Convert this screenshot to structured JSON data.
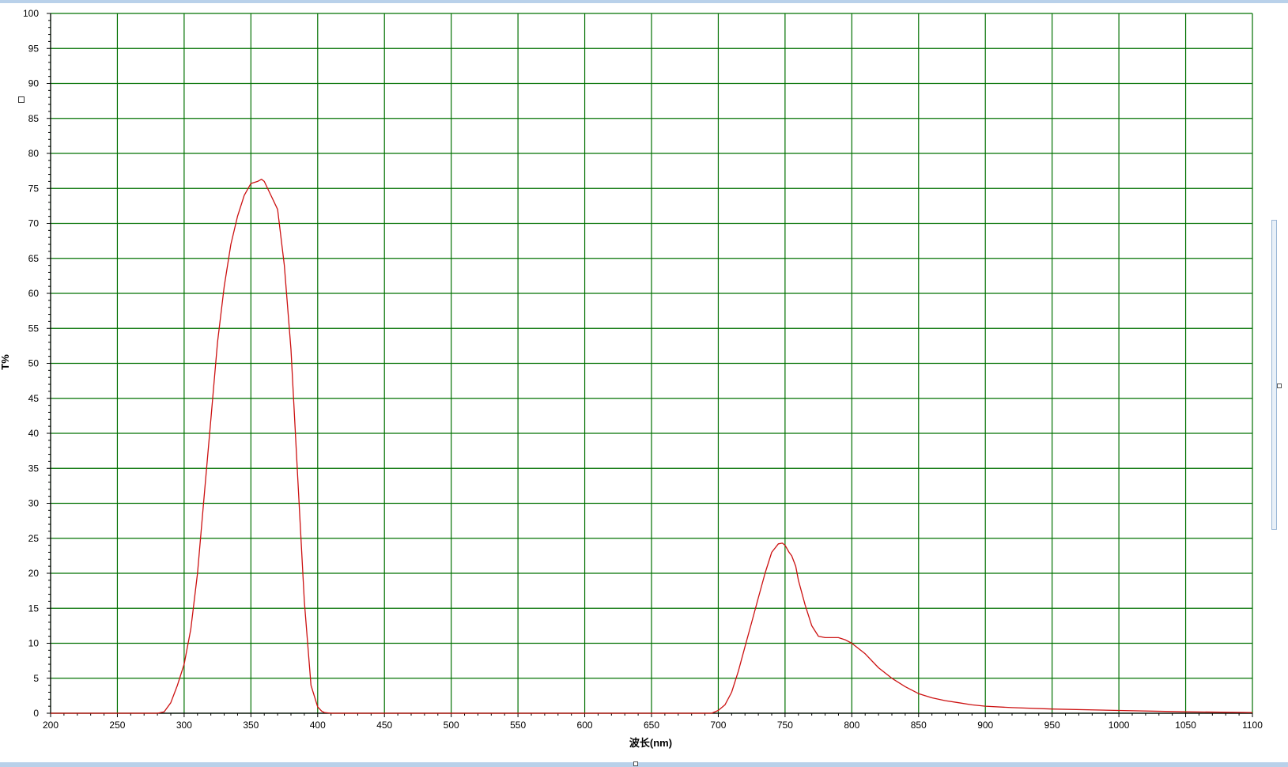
{
  "chart_data": {
    "type": "line",
    "xlabel": "波长(nm)",
    "ylabel": "T%",
    "xlim": [
      200,
      1100
    ],
    "ylim": [
      0,
      100
    ],
    "x_ticks": [
      "200",
      "250",
      "300",
      "350",
      "400",
      "450",
      "500",
      "550",
      "600",
      "650",
      "700",
      "750",
      "800",
      "850",
      "900",
      "950",
      "1000",
      "1050",
      "1100"
    ],
    "y_ticks": [
      "0",
      "5",
      "10",
      "15",
      "20",
      "25",
      "30",
      "35",
      "40",
      "45",
      "50",
      "55",
      "60",
      "65",
      "70",
      "75",
      "80",
      "85",
      "90",
      "95",
      "100"
    ],
    "grid": true,
    "grid_color": "#007000",
    "line_color": "#cc1111",
    "series": [
      {
        "name": "",
        "x": [
          200,
          280,
          285,
          290,
          295,
          300,
          305,
          310,
          315,
          320,
          325,
          330,
          335,
          340,
          345,
          350,
          355,
          358,
          360,
          365,
          370,
          375,
          380,
          385,
          390,
          395,
          400,
          403,
          405,
          410,
          420,
          500,
          600,
          695,
          700,
          705,
          710,
          715,
          720,
          725,
          730,
          735,
          740,
          745,
          748,
          750,
          753,
          755,
          758,
          760,
          765,
          770,
          775,
          780,
          785,
          790,
          795,
          800,
          810,
          820,
          830,
          840,
          850,
          860,
          870,
          880,
          890,
          900,
          920,
          950,
          1000,
          1050,
          1100
        ],
        "y": [
          0,
          0,
          0.2,
          1.5,
          4,
          7,
          12,
          20,
          31,
          42,
          53,
          61,
          67,
          71,
          74,
          75.7,
          76,
          76.3,
          76,
          74,
          72,
          64,
          52,
          34,
          16,
          4,
          0.9,
          0.3,
          0.1,
          0,
          0,
          0,
          0,
          0,
          0.4,
          1.2,
          3,
          6,
          9.5,
          13,
          16.5,
          20,
          23,
          24.2,
          24.3,
          24,
          23,
          22.5,
          21,
          19,
          15.5,
          12.5,
          11,
          10.8,
          10.8,
          10.8,
          10.5,
          10,
          8.5,
          6.5,
          5,
          3.8,
          2.8,
          2.2,
          1.8,
          1.5,
          1.2,
          1.0,
          0.8,
          0.6,
          0.4,
          0.2,
          0.1
        ]
      }
    ]
  }
}
